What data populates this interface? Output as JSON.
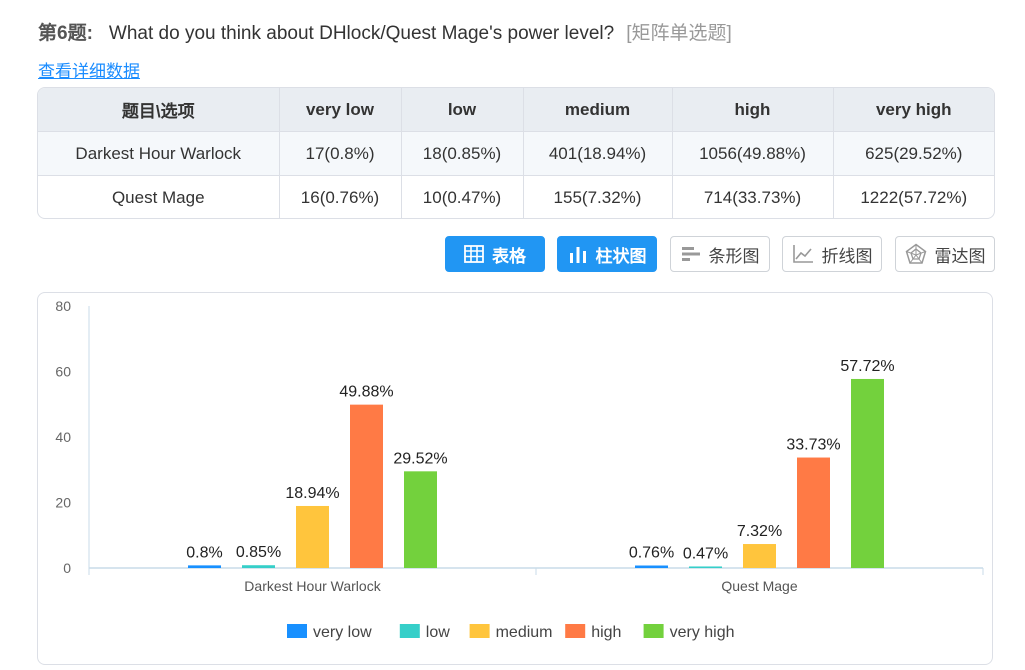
{
  "question": {
    "number": "第6题",
    "separator": ":",
    "text": "What do you think about DHlock/Quest Mage's power level?",
    "type": "[矩阵单选题]",
    "detail_link": "查看详细数据"
  },
  "table": {
    "headers": [
      "题目\\选项",
      "very low",
      "low",
      "medium",
      "high",
      "very high"
    ],
    "rows": [
      [
        "Darkest Hour Warlock",
        "17(0.8%)",
        "18(0.85%)",
        "401(18.94%)",
        "1056(49.88%)",
        "625(29.52%)"
      ],
      [
        "Quest Mage",
        "16(0.76%)",
        "10(0.47%)",
        "155(7.32%)",
        "714(33.73%)",
        "1222(57.72%)"
      ]
    ]
  },
  "view_buttons": [
    {
      "label": "表格",
      "icon": "table-icon",
      "active": true
    },
    {
      "label": "柱状图",
      "icon": "bar-chart-icon",
      "active": true
    },
    {
      "label": "条形图",
      "icon": "horizontal-bar-icon",
      "active": false
    },
    {
      "label": "折线图",
      "icon": "line-chart-icon",
      "active": false
    },
    {
      "label": "雷达图",
      "icon": "radar-chart-icon",
      "active": false
    }
  ],
  "chart_data": {
    "type": "bar",
    "categories": [
      "Darkest Hour Warlock",
      "Quest Mage"
    ],
    "series": [
      {
        "name": "very low",
        "color": "#1890ff",
        "values": [
          0.8,
          0.76
        ]
      },
      {
        "name": "low",
        "color": "#36cfc9",
        "values": [
          0.85,
          0.47
        ]
      },
      {
        "name": "medium",
        "color": "#ffc53d",
        "values": [
          18.94,
          7.32
        ]
      },
      {
        "name": "high",
        "color": "#ff7a45",
        "values": [
          49.88,
          33.73
        ]
      },
      {
        "name": "very high",
        "color": "#73d13d",
        "values": [
          29.52,
          57.72
        ]
      }
    ],
    "ylim": [
      0,
      80
    ],
    "yticks": [
      0,
      20,
      40,
      60,
      80
    ],
    "value_suffix": "%",
    "legend_position": "bottom-center",
    "grid": false
  }
}
